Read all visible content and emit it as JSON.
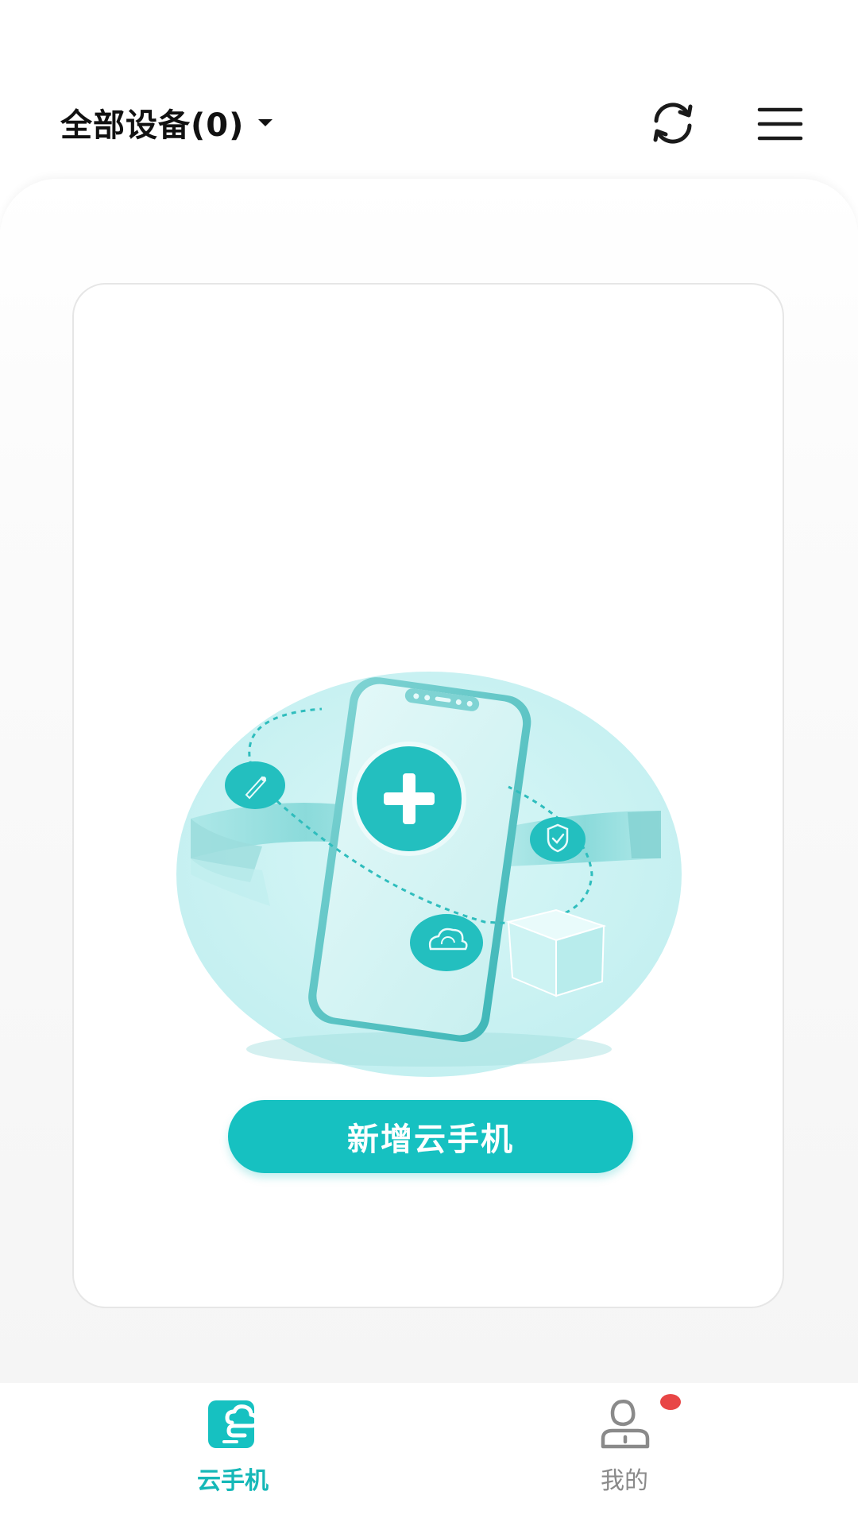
{
  "header": {
    "device_selector_label": "全部设备(0)",
    "caret_icon": "chevron-down-icon",
    "refresh_icon": "refresh-icon",
    "menu_icon": "hamburger-menu-icon"
  },
  "main": {
    "add_button_label": "新增云手机",
    "illustration": "phone-with-plus-illustration"
  },
  "bottom_nav": {
    "items": [
      {
        "label": "云手机",
        "icon": "cloud-phone-icon",
        "active": true
      },
      {
        "label": "我的",
        "icon": "user-icon",
        "active": false,
        "badge": true
      }
    ]
  },
  "colors": {
    "accent": "#16c1c1",
    "badge": "#e84646",
    "text_primary": "#111111",
    "text_inactive": "#8a8a8a"
  }
}
